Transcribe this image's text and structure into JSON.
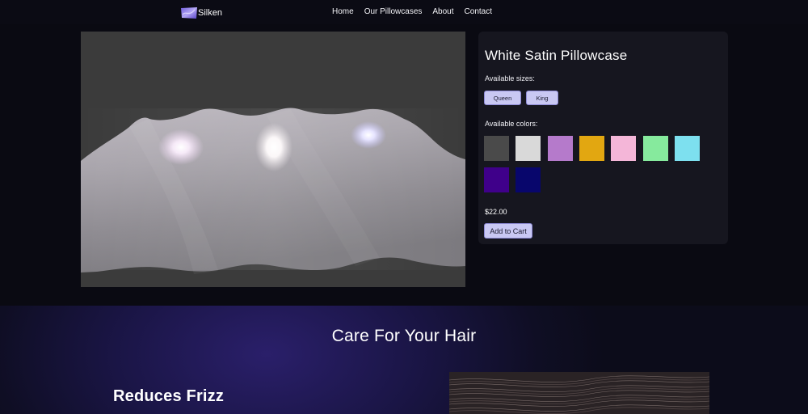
{
  "nav": {
    "brand": "Silken",
    "links": [
      "Home",
      "Our Pillowcases",
      "About",
      "Contact"
    ]
  },
  "product": {
    "title": "White Satin Pillowcase",
    "sizes_label": "Available sizes:",
    "sizes": [
      "Queen",
      "King"
    ],
    "colors_label": "Available colors:",
    "colors": [
      "#4a4a4a",
      "#d9d9d9",
      "#b57acb",
      "#e2a711",
      "#f4b6d8",
      "#86ea9d",
      "#7de0ef",
      "#3f008a",
      "#08066c"
    ],
    "price": "$22.00",
    "add_to_cart": "Add to Cart"
  },
  "care": {
    "title": "Care For Your Hair",
    "feature_title": "Reduces Frizz"
  },
  "theme": {
    "accent": "#c9c8f3",
    "background": "#0a0a12",
    "panel": "#16161f"
  }
}
